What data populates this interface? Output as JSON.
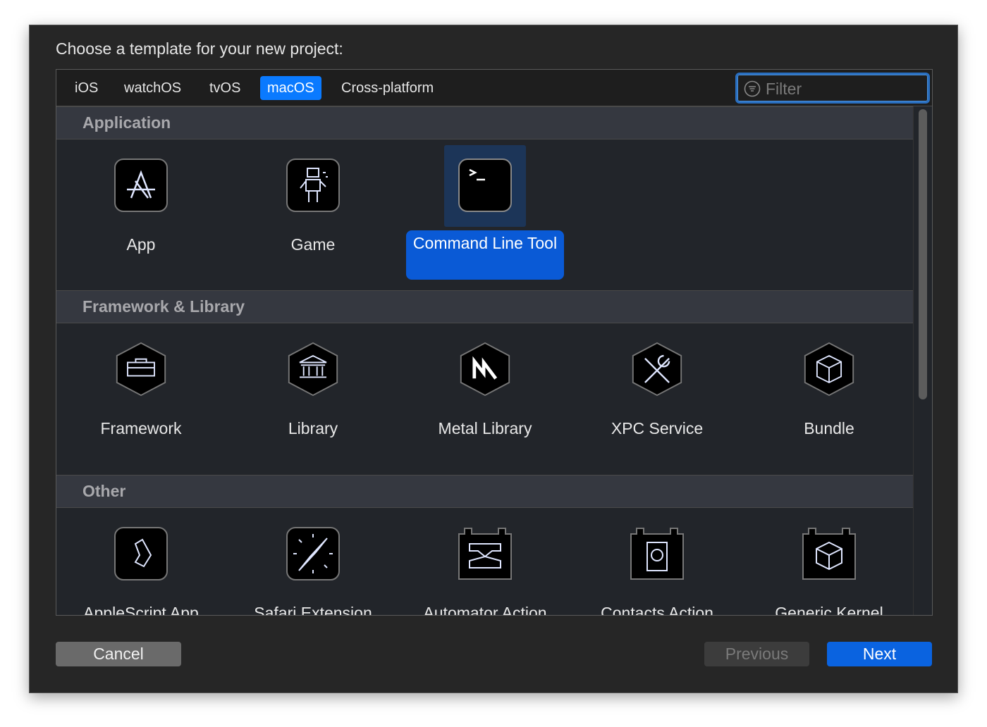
{
  "dialog": {
    "title": "Choose a template for your new project:"
  },
  "tabs": [
    {
      "label": "iOS"
    },
    {
      "label": "watchOS"
    },
    {
      "label": "tvOS"
    },
    {
      "label": "macOS",
      "selected": true
    },
    {
      "label": "Cross-platform"
    }
  ],
  "filter": {
    "placeholder": "Filter",
    "icon": "filter-icon"
  },
  "sections": [
    {
      "title": "Application",
      "items": [
        {
          "label": "App",
          "icon": "app-store-icon"
        },
        {
          "label": "Game",
          "icon": "game-robot-icon"
        },
        {
          "label": "Command Line Tool",
          "icon": "terminal-icon",
          "selected": true
        }
      ]
    },
    {
      "title": "Framework & Library",
      "items": [
        {
          "label": "Framework",
          "icon": "toolbox-icon"
        },
        {
          "label": "Library",
          "icon": "library-building-icon"
        },
        {
          "label": "Metal Library",
          "icon": "metal-icon"
        },
        {
          "label": "XPC Service",
          "icon": "tools-icon"
        },
        {
          "label": "Bundle",
          "icon": "cube-icon"
        }
      ]
    },
    {
      "title": "Other",
      "items": [
        {
          "label": "AppleScript App",
          "icon": "applescript-icon"
        },
        {
          "label": "Safari Extension",
          "icon": "compass-icon"
        },
        {
          "label": "Automator Action",
          "icon": "automator-icon"
        },
        {
          "label": "Contacts Action",
          "icon": "contacts-icon"
        },
        {
          "label": "Generic Kernel",
          "icon": "kernel-cube-icon"
        }
      ]
    }
  ],
  "buttons": {
    "cancel": "Cancel",
    "previous": "Previous",
    "next": "Next"
  },
  "colors": {
    "accent": "#0a7aff",
    "selection": "#0a5ad6",
    "window": "#262626"
  }
}
